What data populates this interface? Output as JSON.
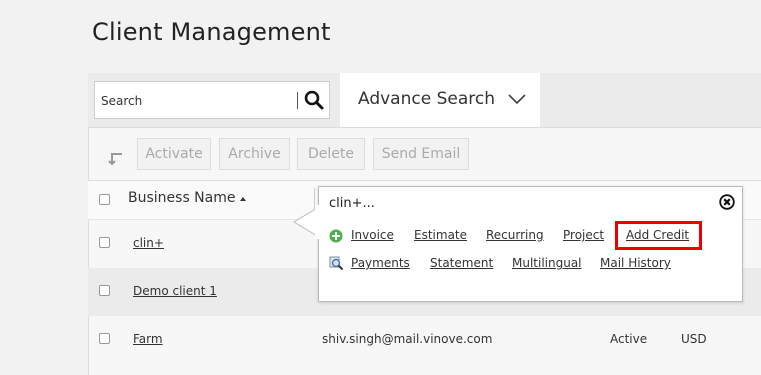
{
  "page_title": "Client Management",
  "search": {
    "placeholder": "Search",
    "advance_label": "Advance Search"
  },
  "toolbar": {
    "activate": "Activate",
    "archive": "Archive",
    "delete": "Delete",
    "send_email": "Send Email"
  },
  "table": {
    "header_business": "Business Name",
    "rows": [
      {
        "name": "clin+",
        "email": "",
        "status": "",
        "currency": ""
      },
      {
        "name": "Demo client 1",
        "email": "",
        "status": "",
        "currency": ""
      },
      {
        "name": "Farm",
        "email": "shiv.singh@mail.vinove.com",
        "status": "Active",
        "currency": "USD"
      }
    ]
  },
  "popup": {
    "title": "clin+...",
    "row1": [
      "Invoice",
      "Estimate",
      "Recurring",
      "Project",
      "Add Credit"
    ],
    "row2": [
      "Payments",
      "Statement",
      "Multilingual",
      "Mail History"
    ]
  },
  "colors": {
    "highlight": "#e00000",
    "add_icon": "#4caf50"
  }
}
